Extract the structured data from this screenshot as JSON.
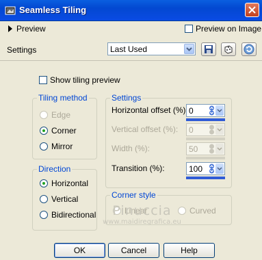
{
  "window": {
    "title": "Seamless Tiling"
  },
  "preview": {
    "label": "Preview",
    "preview_on_image_label": "Preview on Image"
  },
  "settings_bar": {
    "label": "Settings",
    "preset_value": "Last Used"
  },
  "show_tiling_preview": {
    "label": "Show tiling preview"
  },
  "tiling_method": {
    "title": "Tiling method",
    "options": [
      {
        "label": "Edge",
        "checked": false,
        "disabled": true
      },
      {
        "label": "Corner",
        "checked": true,
        "disabled": false
      },
      {
        "label": "Mirror",
        "checked": false,
        "disabled": false
      }
    ]
  },
  "direction": {
    "title": "Direction",
    "options": [
      {
        "label": "Horizontal",
        "checked": true
      },
      {
        "label": "Vertical",
        "checked": false
      },
      {
        "label": "Bidirectional",
        "checked": false
      }
    ]
  },
  "settings_group": {
    "title": "Settings",
    "fields": [
      {
        "label": "Horizontal offset (%):",
        "value": "0",
        "disabled": false
      },
      {
        "label": "Vertical offset (%):",
        "value": "0",
        "disabled": true
      },
      {
        "label": "Width (%):",
        "value": "50",
        "disabled": true
      },
      {
        "label": "Transition (%):",
        "value": "100",
        "disabled": false
      }
    ]
  },
  "corner_style": {
    "title": "Corner style",
    "options": [
      {
        "label": "Linear",
        "checked": false,
        "disabled": true
      },
      {
        "label": "Curved",
        "checked": false,
        "disabled": true
      }
    ]
  },
  "watermark": {
    "line1": "Pinuccia",
    "line2": "www.maidiregrafica.eu"
  },
  "buttons": {
    "ok": "OK",
    "cancel": "Cancel",
    "help": "Help"
  },
  "colors": {
    "title_bar": "#0348d1",
    "group_label": "#0046d5",
    "dialog_bg": "#ece9d8"
  }
}
